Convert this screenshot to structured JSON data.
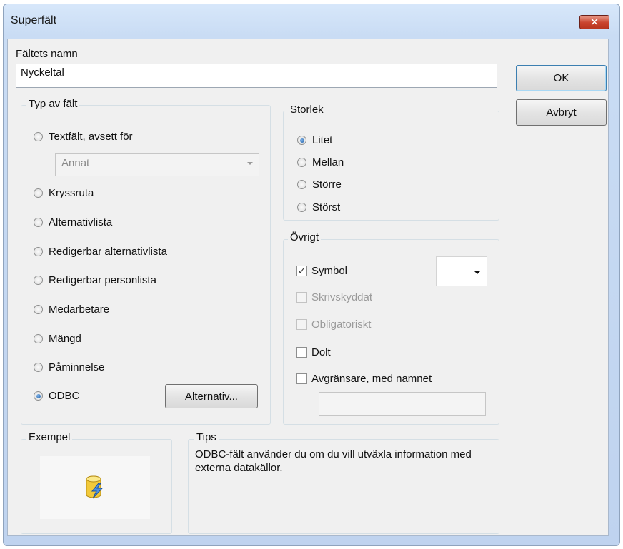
{
  "window": {
    "title": "Superfält",
    "close_icon": "close-icon"
  },
  "field_name": {
    "label": "Fältets namn",
    "value": "Nyckeltal"
  },
  "buttons": {
    "ok": "OK",
    "cancel": "Avbryt",
    "alternatives": "Alternativ..."
  },
  "field_type": {
    "legend": "Typ av fält",
    "options": [
      {
        "label": "Textfält, avsett för",
        "selected": false
      },
      {
        "label": "Kryssruta",
        "selected": false
      },
      {
        "label": "Alternativlista",
        "selected": false
      },
      {
        "label": "Redigerbar alternativlista",
        "selected": false
      },
      {
        "label": "Redigerbar personlista",
        "selected": false
      },
      {
        "label": "Medarbetare",
        "selected": false
      },
      {
        "label": "Mängd",
        "selected": false
      },
      {
        "label": "Påminnelse",
        "selected": false
      },
      {
        "label": "ODBC",
        "selected": true
      }
    ],
    "text_for_select": {
      "value": "Annat"
    }
  },
  "size": {
    "legend": "Storlek",
    "options": [
      {
        "label": "Litet",
        "selected": true
      },
      {
        "label": "Mellan",
        "selected": false
      },
      {
        "label": "Större",
        "selected": false
      },
      {
        "label": "Störst",
        "selected": false
      }
    ]
  },
  "other": {
    "legend": "Övrigt",
    "options": [
      {
        "label": "Symbol",
        "checked": true,
        "enabled": true
      },
      {
        "label": "Skrivskyddat",
        "checked": false,
        "enabled": false
      },
      {
        "label": "Obligatoriskt",
        "checked": false,
        "enabled": false
      },
      {
        "label": "Dolt",
        "checked": false,
        "enabled": true
      },
      {
        "label": "Avgränsare, med namnet",
        "checked": false,
        "enabled": true
      }
    ],
    "separator_name": {
      "value": ""
    }
  },
  "example": {
    "legend": "Exempel",
    "icon": "database-lightning-icon"
  },
  "tips": {
    "legend": "Tips",
    "text": "ODBC-fält använder du om du vill utväxla information med externa datakällor."
  },
  "colors": {
    "title_bar": "#c9dcf4",
    "close_button": "#c9432d",
    "dialog_bg": "#f0f0f0"
  }
}
